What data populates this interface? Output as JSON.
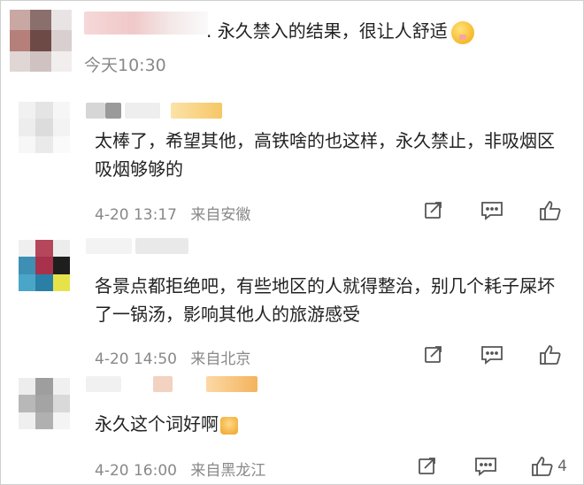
{
  "top_comment": {
    "text": ". 永久禁入的结果，很让人舒适",
    "emoji": "flushed-face",
    "time": "今天10:30"
  },
  "replies": [
    {
      "text": "太棒了，希望其他，高铁啥的也这样，永久禁止，非吸烟区吸烟够够的",
      "date": "4-20 13:17",
      "location": "来自安徽",
      "likes": ""
    },
    {
      "text": "各景点都拒绝吧，有些地区的人就得整治，别几个耗子屎坏了一锅汤，影响其他人的旅游感受",
      "date": "4-20 14:50",
      "location": "来自北京",
      "likes": ""
    },
    {
      "text": "永久这个词好啊",
      "emoji": "thumbs-up",
      "date": "4-20 16:00",
      "location": "来自黑龙江",
      "likes": "4"
    }
  ],
  "colors": {
    "text": "#222222",
    "meta": "#888888",
    "icon": "#555555"
  }
}
